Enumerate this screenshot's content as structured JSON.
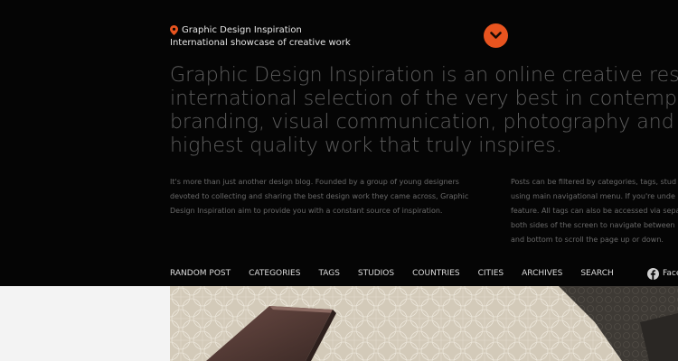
{
  "brand": {
    "name": "Graphic Design Inspiration",
    "tagline": "International showcase of creative work",
    "accent_color": "#e8541f"
  },
  "intro": {
    "lines": [
      "Graphic Design Inspiration is an online creative resource",
      "international selection of the very best in contemporary g",
      "branding, visual communication, photography and illustr",
      "highest quality work that truly inspires."
    ]
  },
  "about": {
    "left_lines": [
      "It's more than just another design blog. Founded by a group of young designers",
      "devoted to collecting and sharing the best design work they came across, Graphic",
      "Design Inspiration aim to provide you with a constant source of inspiration."
    ],
    "right_lines": [
      "Posts can be filtered by categories, tags, stud",
      "using main navigational menu. If you're unde",
      "feature. All tags can also be accessed via sepa",
      "both sides of the screen to navigate between",
      "and bottom to scroll the page up or down."
    ]
  },
  "nav": {
    "items": [
      "RANDOM POST",
      "CATEGORIES",
      "TAGS",
      "STUDIOS",
      "COUNTRIES",
      "CITIES",
      "ARCHIVES",
      "SEARCH"
    ]
  },
  "social": {
    "facebook_label": "Face",
    "icon": "facebook-icon"
  },
  "icons": {
    "location": "location-pin-icon",
    "toggle": "chevron-down-icon"
  }
}
